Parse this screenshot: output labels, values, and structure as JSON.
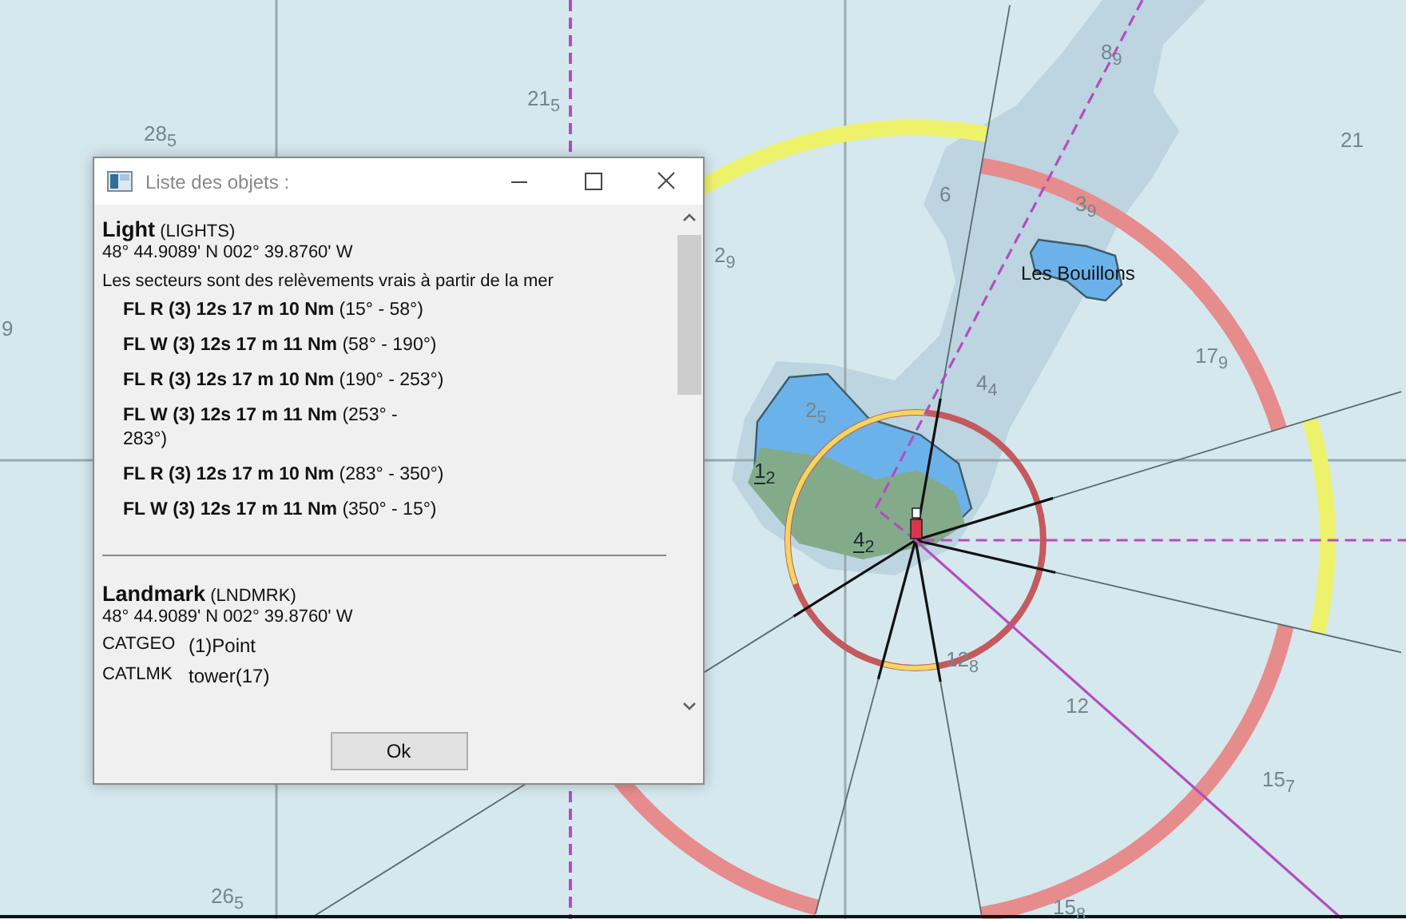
{
  "chart": {
    "soundings": [
      {
        "text": "28$_{5}$",
        "drying": false
      },
      {
        "text": "21$_{5}$",
        "drying": false
      },
      {
        "text": "9",
        "drying": false
      },
      {
        "text": "2$_{9}$",
        "drying": false
      },
      {
        "text": "8$_{9}$",
        "drying": false
      },
      {
        "text": "21",
        "drying": false
      },
      {
        "text": "6",
        "drying": false
      },
      {
        "text": "3$_{9}$",
        "drying": false
      },
      {
        "text": "17$_{9}$",
        "drying": false
      },
      {
        "text": "4$_{4}$",
        "drying": false
      },
      {
        "text": "2$_{5}$",
        "drying": false
      },
      {
        "text": "1$_{2}$",
        "drying": true
      },
      {
        "text": "4$_{2}$",
        "drying": true
      },
      {
        "text": "12$_{8}$",
        "drying": false
      },
      {
        "text": "12",
        "drying": false
      },
      {
        "text": "15$_{7}$",
        "drying": false
      },
      {
        "text": "15$_{8}$",
        "drying": false
      },
      {
        "text": "26$_{5}$",
        "drying": false
      }
    ],
    "place_label": "Les Bouillons"
  },
  "dialog": {
    "title": "Liste des objets :",
    "objects": [
      {
        "kind": "light",
        "name": "Light",
        "code": "(LIGHTS)",
        "position": "48° 44.9089' N 002° 39.8760' W",
        "note": "Les secteurs sont des relèvements vrais à partir de la mer",
        "sectors": [
          {
            "characteristic": "FL R (3) 12s 17 m 10 Nm",
            "range": "(15° - 58°)"
          },
          {
            "characteristic": "FL W (3) 12s 17 m 11 Nm",
            "range": "(58° - 190°)"
          },
          {
            "characteristic": "FL R (3) 12s 17 m 10 Nm",
            "range": "(190° - 253°)"
          },
          {
            "characteristic": "FL W (3) 12s 17 m 11 Nm",
            "range": "(253° - 283°)"
          },
          {
            "characteristic": "FL R (3) 12s 17 m 10 Nm",
            "range": "(283° - 350°)"
          },
          {
            "characteristic": "FL W (3) 12s 17 m 11 Nm",
            "range": "(350° - 15°)"
          }
        ]
      },
      {
        "kind": "landmark",
        "name": "Landmark",
        "code": "(LNDMRK)",
        "position": "48° 44.9089' N 002° 39.8760' W",
        "attributes": [
          {
            "key": "CATGEO",
            "value": "(1)Point"
          },
          {
            "key": "CATLMK",
            "value": "tower(17)"
          }
        ]
      }
    ],
    "ok_button": "Ok"
  }
}
